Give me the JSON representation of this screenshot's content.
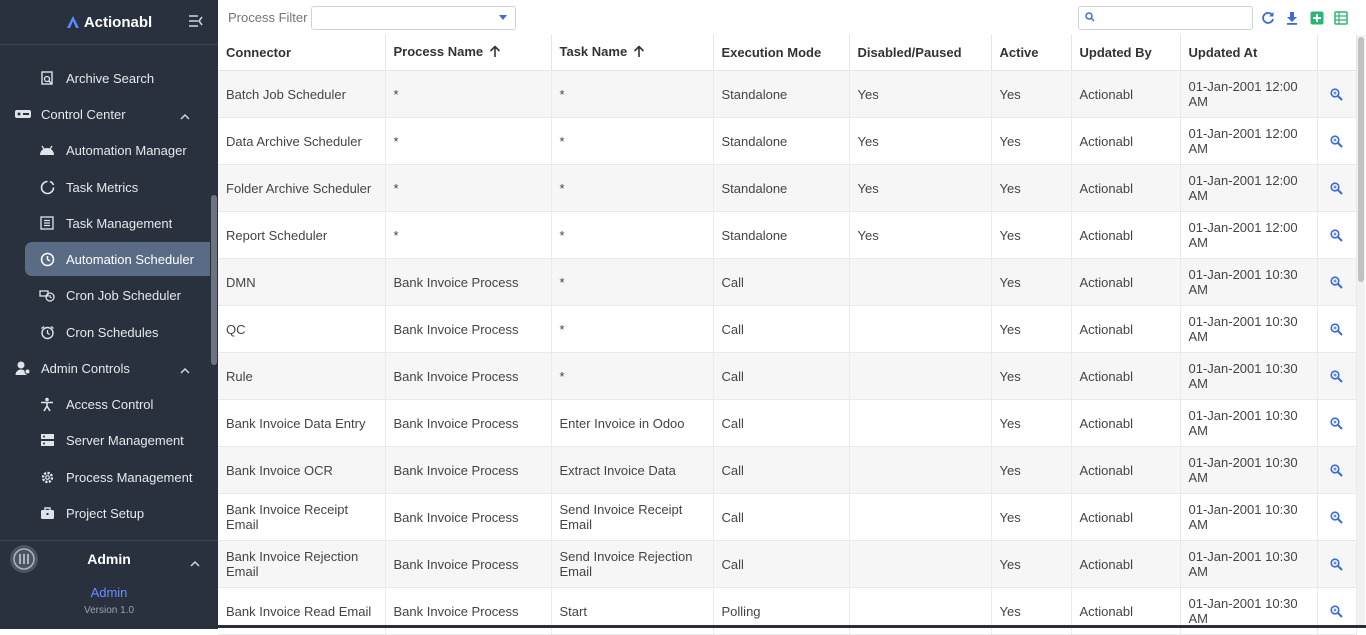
{
  "app": {
    "name": "Actionabl"
  },
  "sidebar": {
    "items": [
      {
        "label": "Archive Search",
        "icon": "archive-search-icon",
        "type": "item",
        "active": false
      },
      {
        "label": "Control Center",
        "icon": "control-center-icon",
        "type": "group",
        "expanded": true
      },
      {
        "label": "Automation Manager",
        "icon": "robot-icon",
        "type": "item",
        "active": false
      },
      {
        "label": "Task Metrics",
        "icon": "metrics-icon",
        "type": "item",
        "active": false
      },
      {
        "label": "Task Management",
        "icon": "list-icon",
        "type": "item",
        "active": false
      },
      {
        "label": "Automation Scheduler",
        "icon": "clock-icon",
        "type": "item",
        "active": true
      },
      {
        "label": "Cron Job Scheduler",
        "icon": "cron-job-icon",
        "type": "item",
        "active": false
      },
      {
        "label": "Cron Schedules",
        "icon": "alarm-icon",
        "type": "item",
        "active": false
      },
      {
        "label": "Admin Controls",
        "icon": "admin-controls-icon",
        "type": "group",
        "expanded": true
      },
      {
        "label": "Access Control",
        "icon": "person-icon",
        "type": "item",
        "active": false
      },
      {
        "label": "Server Management",
        "icon": "server-icon",
        "type": "item",
        "active": false
      },
      {
        "label": "Process Management",
        "icon": "gear-icon",
        "type": "item",
        "active": false
      },
      {
        "label": "Project Setup",
        "icon": "briefcase-icon",
        "type": "item",
        "active": false
      }
    ],
    "user": {
      "name": "Admin",
      "role": "Admin",
      "version": "Version 1.0"
    }
  },
  "toolbar": {
    "process_filter_label": "Process Filter",
    "process_filter_value": "",
    "search_value": ""
  },
  "table": {
    "columns": [
      "Connector",
      "Process Name",
      "Task Name",
      "Execution Mode",
      "Disabled/Paused",
      "Active",
      "Updated By",
      "Updated At",
      ""
    ],
    "sorted_columns": [
      "Process Name",
      "Task Name"
    ],
    "rows": [
      [
        "Batch Job Scheduler",
        "*",
        "*",
        "Standalone",
        "Yes",
        "Yes",
        "Actionabl",
        "01-Jan-2001 12:00 AM"
      ],
      [
        "Data Archive Scheduler",
        "*",
        "*",
        "Standalone",
        "Yes",
        "Yes",
        "Actionabl",
        "01-Jan-2001 12:00 AM"
      ],
      [
        "Folder Archive Scheduler",
        "*",
        "*",
        "Standalone",
        "Yes",
        "Yes",
        "Actionabl",
        "01-Jan-2001 12:00 AM"
      ],
      [
        "Report Scheduler",
        "*",
        "*",
        "Standalone",
        "Yes",
        "Yes",
        "Actionabl",
        "01-Jan-2001 12:00 AM"
      ],
      [
        "DMN",
        "Bank Invoice Process",
        "*",
        "Call",
        "",
        "Yes",
        "Actionabl",
        "01-Jan-2001 10:30 AM"
      ],
      [
        "QC",
        "Bank Invoice Process",
        "*",
        "Call",
        "",
        "Yes",
        "Actionabl",
        "01-Jan-2001 10:30 AM"
      ],
      [
        "Rule",
        "Bank Invoice Process",
        "*",
        "Call",
        "",
        "Yes",
        "Actionabl",
        "01-Jan-2001 10:30 AM"
      ],
      [
        "Bank Invoice Data Entry",
        "Bank Invoice Process",
        "Enter Invoice in Odoo",
        "Call",
        "",
        "Yes",
        "Actionabl",
        "01-Jan-2001 10:30 AM"
      ],
      [
        "Bank Invoice OCR",
        "Bank Invoice Process",
        "Extract Invoice Data",
        "Call",
        "",
        "Yes",
        "Actionabl",
        "01-Jan-2001 10:30 AM"
      ],
      [
        "Bank Invoice Receipt Email",
        "Bank Invoice Process",
        "Send Invoice Receipt Email",
        "Call",
        "",
        "Yes",
        "Actionabl",
        "01-Jan-2001 10:30 AM"
      ],
      [
        "Bank Invoice Rejection Email",
        "Bank Invoice Process",
        "Send Invoice Rejection Email",
        "Call",
        "",
        "Yes",
        "Actionabl",
        "01-Jan-2001 10:30 AM"
      ],
      [
        "Bank Invoice Read Email",
        "Bank Invoice Process",
        "Start",
        "Polling",
        "",
        "Yes",
        "Actionabl",
        "01-Jan-2001 10:30 AM"
      ]
    ]
  },
  "colors": {
    "sidebar_bg": "#28313d",
    "active_item_bg": "#5a6b86",
    "accent_blue": "#3a6bd9",
    "add_green": "#2bb673"
  }
}
